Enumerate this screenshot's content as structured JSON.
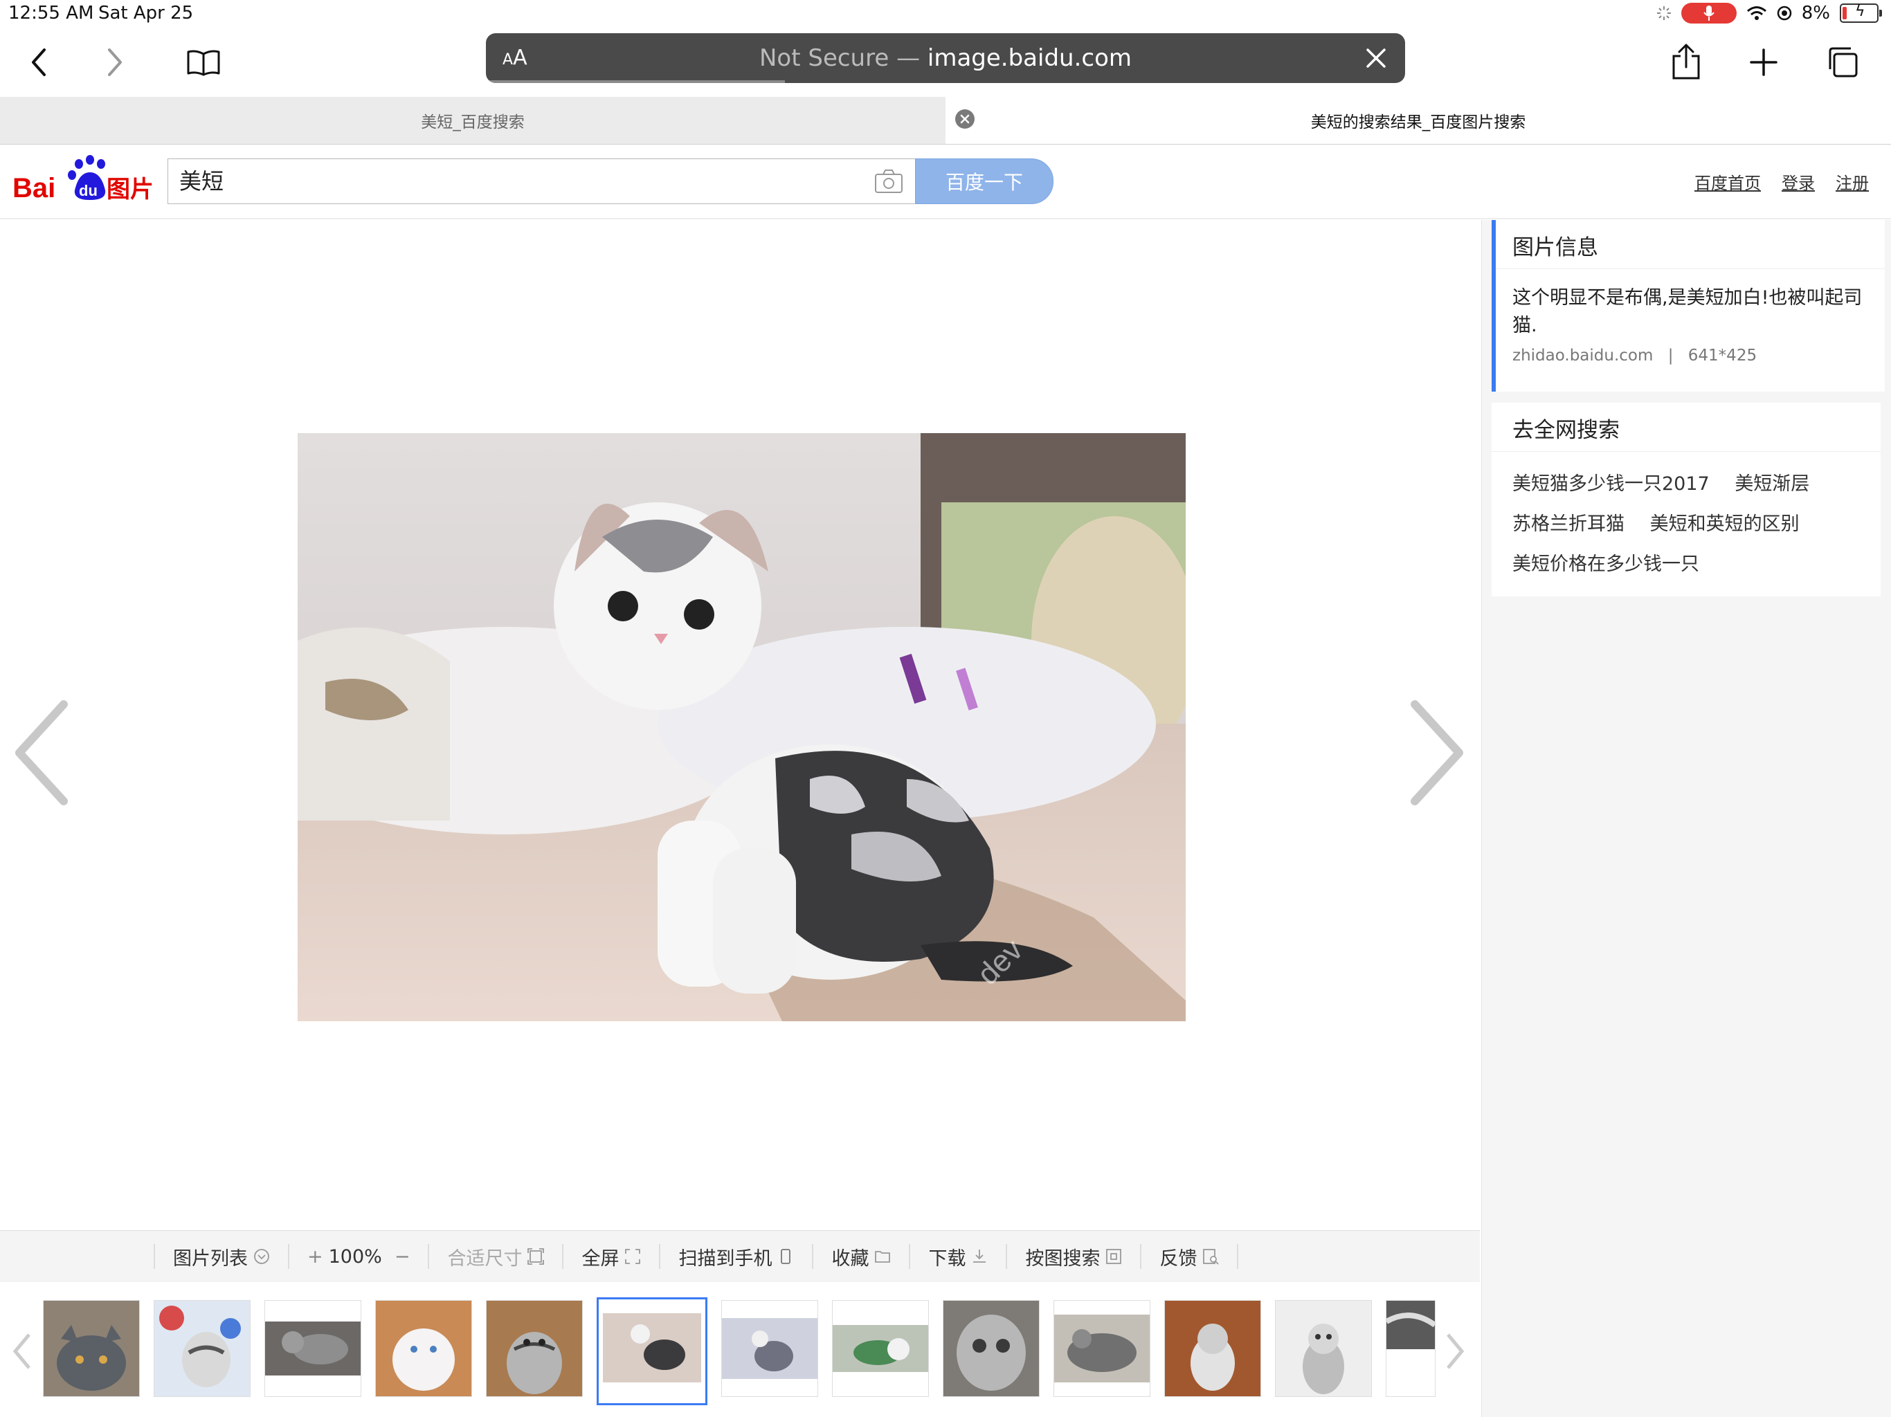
{
  "status": {
    "time": "12:55 AM",
    "date": "Sat Apr 25",
    "battery": "8%"
  },
  "toolbar": {
    "aa_label": "AA",
    "not_secure": "Not Secure",
    "separator": "—",
    "domain": "image.baidu.com"
  },
  "tabs": [
    {
      "title": "美短_百度搜索",
      "active": false
    },
    {
      "title": "美短的搜索结果_百度图片搜索",
      "active": true
    }
  ],
  "header": {
    "logo_text_en": "Bai",
    "logo_text_du": "du",
    "logo_text_cn": "图片",
    "search_value": "美短",
    "search_button": "百度一下",
    "links": [
      "百度首页",
      "登录",
      "注册"
    ]
  },
  "sidebar": {
    "info_title": "图片信息",
    "info_desc": "这个明显不是布偶,是美短加白!也被叫起司猫.",
    "info_source": "zhidao.baidu.com",
    "info_divider": "|",
    "info_size": "641*425",
    "web_title": "去全网搜索",
    "suggestions": [
      [
        "美短猫多少钱一只2017",
        "美短渐层"
      ],
      [
        "苏格兰折耳猫",
        "美短和英短的区别"
      ],
      [
        "美短价格在多少钱一只"
      ]
    ]
  },
  "viewbar": {
    "list": "图片列表",
    "zoom_in": "+",
    "zoom_level": "100%",
    "zoom_out": "−",
    "fit": "合适尺寸",
    "fullscreen": "全屏",
    "scan": "扫描到手机",
    "collect": "收藏",
    "download": "下载",
    "search_by_image": "按图搜索",
    "feedback": "反馈"
  },
  "colors": {
    "accent": "#3b7bf3",
    "search_button": "#8fb4ea",
    "baidu_red": "#e10601",
    "baidu_blue": "#2319dc",
    "mic_red": "#e53935"
  }
}
